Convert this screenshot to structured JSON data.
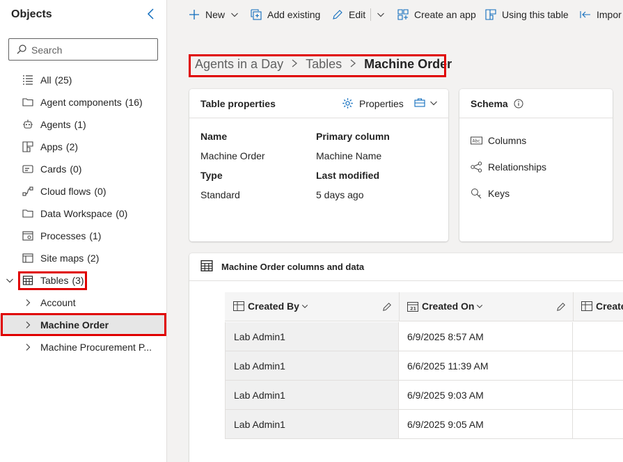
{
  "sidebar": {
    "title": "Objects",
    "search_placeholder": "Search",
    "items": [
      {
        "label": "All",
        "count": "(25)"
      },
      {
        "label": "Agent components",
        "count": "(16)"
      },
      {
        "label": "Agents",
        "count": "(1)"
      },
      {
        "label": "Apps",
        "count": "(2)"
      },
      {
        "label": "Cards",
        "count": "(0)"
      },
      {
        "label": "Cloud flows",
        "count": "(0)"
      },
      {
        "label": "Data Workspace",
        "count": "(0)"
      },
      {
        "label": "Processes",
        "count": "(1)"
      },
      {
        "label": "Site maps",
        "count": "(2)"
      },
      {
        "label": "Tables",
        "count": "(3)"
      }
    ],
    "tables": [
      {
        "label": "Account"
      },
      {
        "label": "Machine Order"
      },
      {
        "label": "Machine Procurement P..."
      }
    ]
  },
  "toolbar": {
    "new_label": "New",
    "add_existing_label": "Add existing",
    "edit_label": "Edit",
    "create_app_label": "Create an app",
    "using_table_label": "Using this table",
    "import_label": "Impor"
  },
  "breadcrumb": {
    "items": [
      "Agents in a Day",
      "Tables",
      "Machine Order"
    ]
  },
  "table_properties": {
    "title": "Table properties",
    "properties_label": "Properties",
    "name_label": "Name",
    "name_value": "Machine Order",
    "type_label": "Type",
    "type_value": "Standard",
    "primary_column_label": "Primary column",
    "primary_column_value": "Machine Name",
    "last_modified_label": "Last modified",
    "last_modified_value": "5 days ago"
  },
  "schema": {
    "title": "Schema",
    "links": [
      "Columns",
      "Relationships",
      "Keys"
    ]
  },
  "data_section": {
    "title": "Machine Order columns and data",
    "columns": [
      "Created By",
      "Created On",
      "Create"
    ],
    "rows": [
      {
        "created_by": "Lab Admin1",
        "created_on": "6/9/2025 8:57 AM"
      },
      {
        "created_by": "Lab Admin1",
        "created_on": "6/6/2025 11:39 AM"
      },
      {
        "created_by": "Lab Admin1",
        "created_on": "6/9/2025 9:03 AM"
      },
      {
        "created_by": "Lab Admin1",
        "created_on": "6/9/2025 9:05 AM"
      }
    ]
  },
  "colors": {
    "highlight": "#e00000",
    "accent": "#0f6cbd"
  }
}
